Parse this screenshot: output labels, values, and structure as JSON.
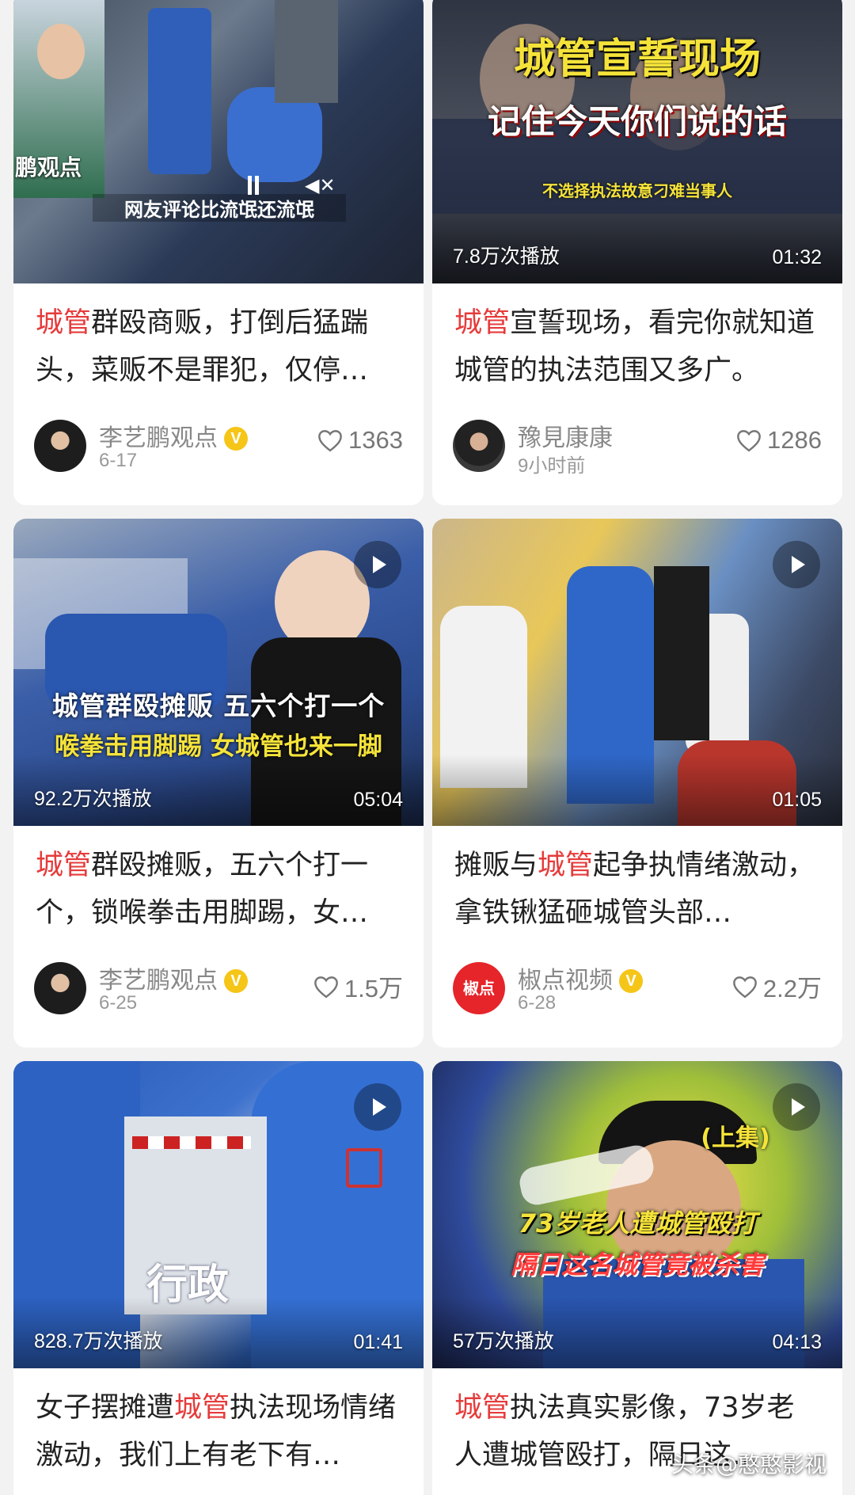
{
  "cards": [
    {
      "title_hl": "城管",
      "title_rest": "群殴商贩，打倒后猛踹头，菜贩不是罪犯，仅停…",
      "author": "李艺鹏观点",
      "verified": true,
      "date": "6-17",
      "likes": "1363",
      "views": "",
      "duration": "",
      "thumb_text_1": "鹏观点",
      "thumb_text_2": "网友评论比流氓还流氓"
    },
    {
      "title_hl": "城管",
      "title_rest": "宣誓现场，看完你就知道城管的执法范围又多广。",
      "author": "豫見康康",
      "verified": false,
      "date": "9小时前",
      "likes": "1286",
      "views": "7.8万次播放",
      "duration": "01:32",
      "thumb_text_1": "城管宣誓现场",
      "thumb_text_2": "记住今天你们说的话",
      "thumb_text_3": "不选择执法故意刁难当事人"
    },
    {
      "title_hl": "城管",
      "title_rest": "群殴摊贩，五六个打一个，锁喉拳击用脚踢，女…",
      "author": "李艺鹏观点",
      "verified": true,
      "date": "6-25",
      "likes": "1.5万",
      "views": "92.2万次播放",
      "duration": "05:04",
      "thumb_text_1": "城管群殴摊贩 五六个打一个",
      "thumb_text_2": "喉拳击用脚踢 女城管也来一脚"
    },
    {
      "title_pre": "摊贩与",
      "title_hl": "城管",
      "title_rest": "起争执情绪激动，拿铁锹猛砸城管头部…",
      "author": "椒点视频",
      "verified": true,
      "date": "6-28",
      "likes": "2.2万",
      "views": "",
      "duration": "01:05",
      "avatar_text": "椒点"
    },
    {
      "title_pre": "女子摆摊遭",
      "title_hl": "城管",
      "title_rest": "执法现场情绪激动，我们上有老下有…",
      "views": "828.7万次播放",
      "duration": "01:41",
      "thumb_text_1": "行政"
    },
    {
      "title_hl": "城管",
      "title_rest": "执法真实影像，73岁老人遭城管殴打，隔日这…",
      "views": "57万次播放",
      "duration": "04:13",
      "thumb_text_1": "(上集)",
      "thumb_text_2": "73岁老人遭城管殴打",
      "thumb_text_3": "隔日这名城管竟被杀害"
    }
  ],
  "watermark": "头条@憨憨影视",
  "colors": {
    "highlight": "#e63b3b",
    "verified": "#f5c518"
  }
}
